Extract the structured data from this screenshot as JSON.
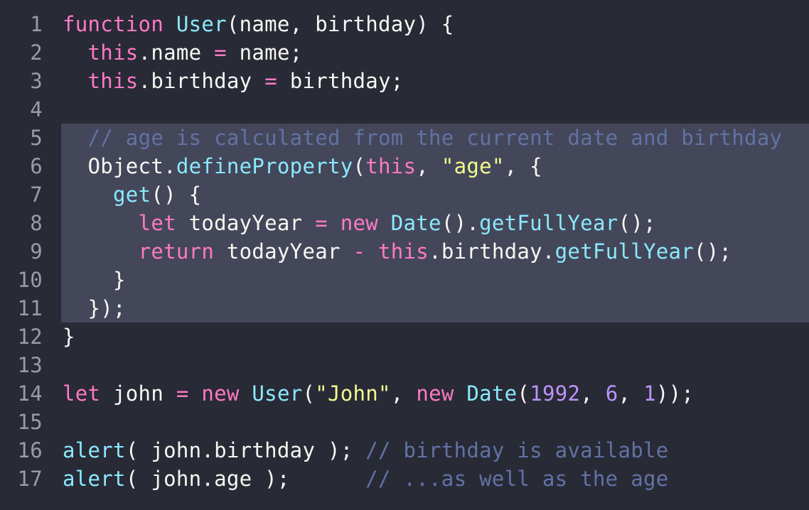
{
  "editor": {
    "highlighted_lines": [
      5,
      11
    ],
    "lines": [
      {
        "n": "1",
        "tokens": [
          [
            "kw",
            "function"
          ],
          [
            "t",
            " "
          ],
          [
            "fn",
            "User"
          ],
          [
            "t",
            "(name, birthday) {"
          ]
        ]
      },
      {
        "n": "2",
        "tokens": [
          [
            "t",
            "  "
          ],
          [
            "kw",
            "this"
          ],
          [
            "t",
            ".name "
          ],
          [
            "op",
            "="
          ],
          [
            "t",
            " name;"
          ]
        ]
      },
      {
        "n": "3",
        "tokens": [
          [
            "t",
            "  "
          ],
          [
            "kw",
            "this"
          ],
          [
            "t",
            ".birthday "
          ],
          [
            "op",
            "="
          ],
          [
            "t",
            " birthday;"
          ]
        ]
      },
      {
        "n": "4",
        "tokens": []
      },
      {
        "n": "5",
        "tokens": [
          [
            "t",
            "  "
          ],
          [
            "cm",
            "// age is calculated from the current date and birthday"
          ]
        ]
      },
      {
        "n": "6",
        "tokens": [
          [
            "t",
            "  Object."
          ],
          [
            "fn",
            "defineProperty"
          ],
          [
            "t",
            "("
          ],
          [
            "kw",
            "this"
          ],
          [
            "t",
            ", "
          ],
          [
            "str",
            "\"age\""
          ],
          [
            "t",
            ", {"
          ]
        ]
      },
      {
        "n": "7",
        "tokens": [
          [
            "t",
            "    "
          ],
          [
            "fn",
            "get"
          ],
          [
            "t",
            "() {"
          ]
        ]
      },
      {
        "n": "8",
        "tokens": [
          [
            "t",
            "      "
          ],
          [
            "kw",
            "let"
          ],
          [
            "t",
            " todayYear "
          ],
          [
            "op",
            "="
          ],
          [
            "t",
            " "
          ],
          [
            "kw",
            "new"
          ],
          [
            "t",
            " "
          ],
          [
            "fn",
            "Date"
          ],
          [
            "t",
            "()."
          ],
          [
            "fn",
            "getFullYear"
          ],
          [
            "t",
            "();"
          ]
        ]
      },
      {
        "n": "9",
        "tokens": [
          [
            "t",
            "      "
          ],
          [
            "kw",
            "return"
          ],
          [
            "t",
            " todayYear "
          ],
          [
            "op",
            "-"
          ],
          [
            "t",
            " "
          ],
          [
            "kw",
            "this"
          ],
          [
            "t",
            ".birthday."
          ],
          [
            "fn",
            "getFullYear"
          ],
          [
            "t",
            "();"
          ]
        ]
      },
      {
        "n": "10",
        "tokens": [
          [
            "t",
            "    }"
          ]
        ]
      },
      {
        "n": "11",
        "tokens": [
          [
            "t",
            "  });"
          ]
        ]
      },
      {
        "n": "12",
        "tokens": [
          [
            "t",
            "}"
          ]
        ]
      },
      {
        "n": "13",
        "tokens": []
      },
      {
        "n": "14",
        "tokens": [
          [
            "kw",
            "let"
          ],
          [
            "t",
            " john "
          ],
          [
            "op",
            "="
          ],
          [
            "t",
            " "
          ],
          [
            "kw",
            "new"
          ],
          [
            "t",
            " "
          ],
          [
            "fn",
            "User"
          ],
          [
            "t",
            "("
          ],
          [
            "str",
            "\"John\""
          ],
          [
            "t",
            ", "
          ],
          [
            "kw",
            "new"
          ],
          [
            "t",
            " "
          ],
          [
            "fn",
            "Date"
          ],
          [
            "t",
            "("
          ],
          [
            "num",
            "1992"
          ],
          [
            "t",
            ", "
          ],
          [
            "num",
            "6"
          ],
          [
            "t",
            ", "
          ],
          [
            "num",
            "1"
          ],
          [
            "t",
            "));"
          ]
        ]
      },
      {
        "n": "15",
        "tokens": []
      },
      {
        "n": "16",
        "tokens": [
          [
            "fn",
            "alert"
          ],
          [
            "t",
            "( john.birthday ); "
          ],
          [
            "cm",
            "// birthday is available"
          ]
        ]
      },
      {
        "n": "17",
        "tokens": [
          [
            "fn",
            "alert"
          ],
          [
            "t",
            "( john.age );      "
          ],
          [
            "cm",
            "// ...as well as the age"
          ]
        ]
      }
    ]
  }
}
